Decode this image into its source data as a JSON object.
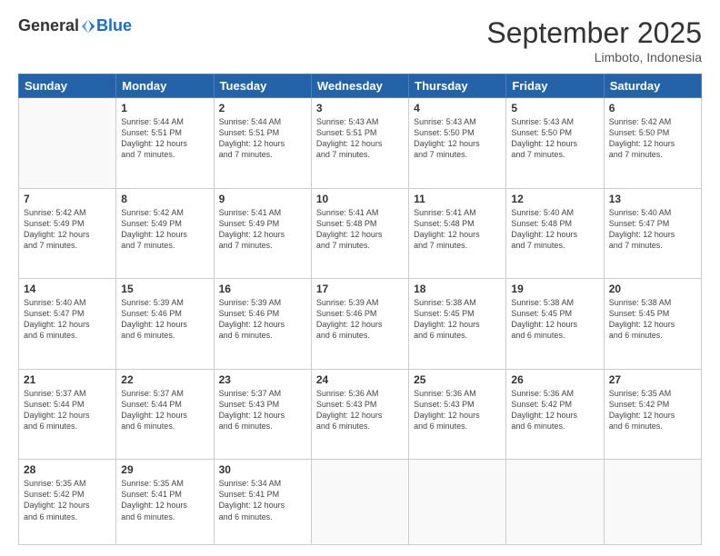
{
  "header": {
    "logo_general": "General",
    "logo_blue": "Blue",
    "month_title": "September 2025",
    "subtitle": "Limboto, Indonesia"
  },
  "weekdays": [
    "Sunday",
    "Monday",
    "Tuesday",
    "Wednesday",
    "Thursday",
    "Friday",
    "Saturday"
  ],
  "weeks": [
    [
      {
        "day": "",
        "info": ""
      },
      {
        "day": "1",
        "info": "Sunrise: 5:44 AM\nSunset: 5:51 PM\nDaylight: 12 hours\nand 7 minutes."
      },
      {
        "day": "2",
        "info": "Sunrise: 5:44 AM\nSunset: 5:51 PM\nDaylight: 12 hours\nand 7 minutes."
      },
      {
        "day": "3",
        "info": "Sunrise: 5:43 AM\nSunset: 5:51 PM\nDaylight: 12 hours\nand 7 minutes."
      },
      {
        "day": "4",
        "info": "Sunrise: 5:43 AM\nSunset: 5:50 PM\nDaylight: 12 hours\nand 7 minutes."
      },
      {
        "day": "5",
        "info": "Sunrise: 5:43 AM\nSunset: 5:50 PM\nDaylight: 12 hours\nand 7 minutes."
      },
      {
        "day": "6",
        "info": "Sunrise: 5:42 AM\nSunset: 5:50 PM\nDaylight: 12 hours\nand 7 minutes."
      }
    ],
    [
      {
        "day": "7",
        "info": "Sunrise: 5:42 AM\nSunset: 5:49 PM\nDaylight: 12 hours\nand 7 minutes."
      },
      {
        "day": "8",
        "info": "Sunrise: 5:42 AM\nSunset: 5:49 PM\nDaylight: 12 hours\nand 7 minutes."
      },
      {
        "day": "9",
        "info": "Sunrise: 5:41 AM\nSunset: 5:49 PM\nDaylight: 12 hours\nand 7 minutes."
      },
      {
        "day": "10",
        "info": "Sunrise: 5:41 AM\nSunset: 5:48 PM\nDaylight: 12 hours\nand 7 minutes."
      },
      {
        "day": "11",
        "info": "Sunrise: 5:41 AM\nSunset: 5:48 PM\nDaylight: 12 hours\nand 7 minutes."
      },
      {
        "day": "12",
        "info": "Sunrise: 5:40 AM\nSunset: 5:48 PM\nDaylight: 12 hours\nand 7 minutes."
      },
      {
        "day": "13",
        "info": "Sunrise: 5:40 AM\nSunset: 5:47 PM\nDaylight: 12 hours\nand 7 minutes."
      }
    ],
    [
      {
        "day": "14",
        "info": "Sunrise: 5:40 AM\nSunset: 5:47 PM\nDaylight: 12 hours\nand 6 minutes."
      },
      {
        "day": "15",
        "info": "Sunrise: 5:39 AM\nSunset: 5:46 PM\nDaylight: 12 hours\nand 6 minutes."
      },
      {
        "day": "16",
        "info": "Sunrise: 5:39 AM\nSunset: 5:46 PM\nDaylight: 12 hours\nand 6 minutes."
      },
      {
        "day": "17",
        "info": "Sunrise: 5:39 AM\nSunset: 5:46 PM\nDaylight: 12 hours\nand 6 minutes."
      },
      {
        "day": "18",
        "info": "Sunrise: 5:38 AM\nSunset: 5:45 PM\nDaylight: 12 hours\nand 6 minutes."
      },
      {
        "day": "19",
        "info": "Sunrise: 5:38 AM\nSunset: 5:45 PM\nDaylight: 12 hours\nand 6 minutes."
      },
      {
        "day": "20",
        "info": "Sunrise: 5:38 AM\nSunset: 5:45 PM\nDaylight: 12 hours\nand 6 minutes."
      }
    ],
    [
      {
        "day": "21",
        "info": "Sunrise: 5:37 AM\nSunset: 5:44 PM\nDaylight: 12 hours\nand 6 minutes."
      },
      {
        "day": "22",
        "info": "Sunrise: 5:37 AM\nSunset: 5:44 PM\nDaylight: 12 hours\nand 6 minutes."
      },
      {
        "day": "23",
        "info": "Sunrise: 5:37 AM\nSunset: 5:43 PM\nDaylight: 12 hours\nand 6 minutes."
      },
      {
        "day": "24",
        "info": "Sunrise: 5:36 AM\nSunset: 5:43 PM\nDaylight: 12 hours\nand 6 minutes."
      },
      {
        "day": "25",
        "info": "Sunrise: 5:36 AM\nSunset: 5:43 PM\nDaylight: 12 hours\nand 6 minutes."
      },
      {
        "day": "26",
        "info": "Sunrise: 5:36 AM\nSunset: 5:42 PM\nDaylight: 12 hours\nand 6 minutes."
      },
      {
        "day": "27",
        "info": "Sunrise: 5:35 AM\nSunset: 5:42 PM\nDaylight: 12 hours\nand 6 minutes."
      }
    ],
    [
      {
        "day": "28",
        "info": "Sunrise: 5:35 AM\nSunset: 5:42 PM\nDaylight: 12 hours\nand 6 minutes."
      },
      {
        "day": "29",
        "info": "Sunrise: 5:35 AM\nSunset: 5:41 PM\nDaylight: 12 hours\nand 6 minutes."
      },
      {
        "day": "30",
        "info": "Sunrise: 5:34 AM\nSunset: 5:41 PM\nDaylight: 12 hours\nand 6 minutes."
      },
      {
        "day": "",
        "info": ""
      },
      {
        "day": "",
        "info": ""
      },
      {
        "day": "",
        "info": ""
      },
      {
        "day": "",
        "info": ""
      }
    ]
  ]
}
